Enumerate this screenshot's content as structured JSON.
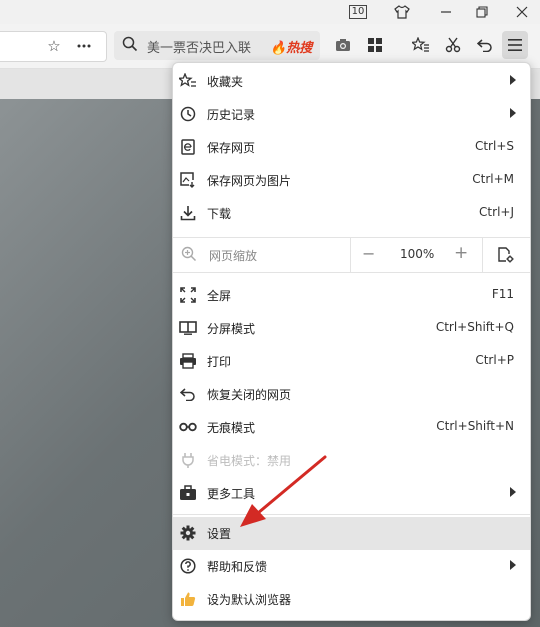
{
  "titlebar": {
    "tab_count": "10"
  },
  "toolbar": {
    "search_placeholder": "美一票否决巴入联",
    "hot_label": "热搜"
  },
  "menu": {
    "items": [
      {
        "label": "收藏夹",
        "shortcut": "",
        "icon": "star-list-icon",
        "submenu": true
      },
      {
        "label": "历史记录",
        "shortcut": "",
        "icon": "clock-icon",
        "submenu": true
      },
      {
        "label": "保存网页",
        "shortcut": "Ctrl+S",
        "icon": "save-page-icon"
      },
      {
        "label": "保存网页为图片",
        "shortcut": "Ctrl+M",
        "icon": "save-image-icon"
      },
      {
        "label": "下载",
        "shortcut": "Ctrl+J",
        "icon": "download-icon"
      }
    ],
    "zoom": {
      "label": "网页缩放",
      "minus": "−",
      "value": "100%",
      "plus": "+"
    },
    "items2": [
      {
        "label": "全屏",
        "shortcut": "F11",
        "icon": "fullscreen-icon"
      },
      {
        "label": "分屏模式",
        "shortcut": "Ctrl+Shift+Q",
        "icon": "split-screen-icon"
      },
      {
        "label": "打印",
        "shortcut": "Ctrl+P",
        "icon": "printer-icon"
      },
      {
        "label": "恢复关闭的网页",
        "shortcut": "",
        "icon": "undo-icon"
      },
      {
        "label": "无痕模式",
        "shortcut": "Ctrl+Shift+N",
        "icon": "incognito-icon"
      },
      {
        "label": "省电模式：禁用",
        "shortcut": "",
        "icon": "plug-icon",
        "disabled": true
      },
      {
        "label": "更多工具",
        "shortcut": "",
        "icon": "toolbox-icon",
        "submenu": true
      }
    ],
    "items3": [
      {
        "label": "设置",
        "icon": "gear-icon",
        "highlighted": true
      },
      {
        "label": "帮助和反馈",
        "icon": "help-icon",
        "submenu": true
      },
      {
        "label": "设为默认浏览器",
        "icon": "thumbs-up-icon"
      }
    ]
  },
  "colors": {
    "hot": "#e03a1e",
    "arrow": "#d32a24",
    "highlight": "#e5e5e5"
  }
}
